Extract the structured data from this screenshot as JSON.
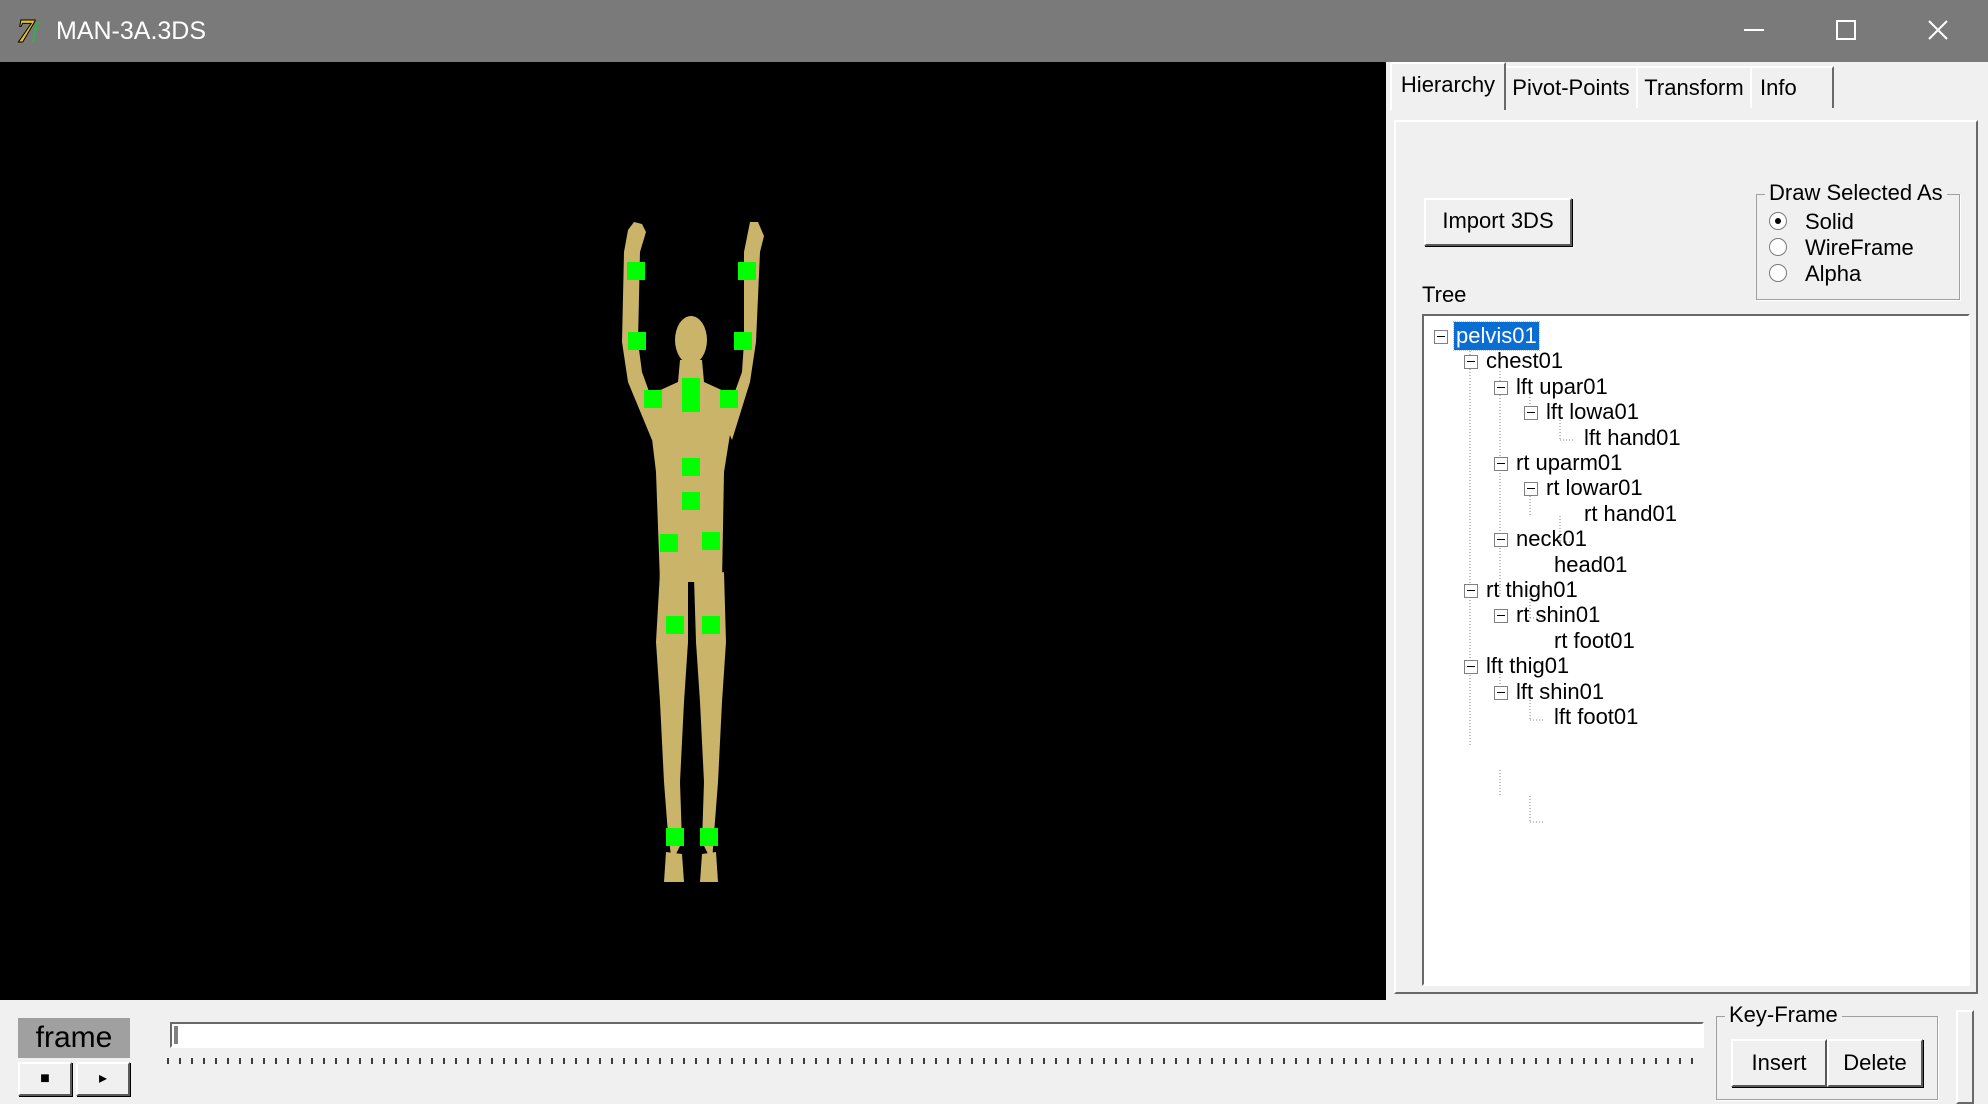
{
  "window": {
    "title": "MAN-3A.3DS"
  },
  "tabs": [
    {
      "label": "Hierarchy",
      "active": true
    },
    {
      "label": "Pivot-Points",
      "active": false
    },
    {
      "label": "Transform",
      "active": false
    },
    {
      "label": "Info",
      "active": false
    }
  ],
  "hierarchy": {
    "import_label": "Import 3DS",
    "draw_selected": {
      "title": "Draw Selected As",
      "options": [
        "Solid",
        "WireFrame",
        "Alpha"
      ],
      "selected": "Solid"
    },
    "tree_label": "Tree",
    "tree_nodes": [
      {
        "label": "pelvis01",
        "depth": 0,
        "expandable": true,
        "selected": true
      },
      {
        "label": "chest01",
        "depth": 1,
        "expandable": true
      },
      {
        "label": "lft upar01",
        "depth": 2,
        "expandable": true
      },
      {
        "label": "lft lowa01",
        "depth": 3,
        "expandable": true
      },
      {
        "label": "lft hand01",
        "depth": 4,
        "expandable": false
      },
      {
        "label": "rt uparm01",
        "depth": 2,
        "expandable": true
      },
      {
        "label": "rt lowar01",
        "depth": 3,
        "expandable": true
      },
      {
        "label": "rt hand01",
        "depth": 4,
        "expandable": false
      },
      {
        "label": "neck01",
        "depth": 2,
        "expandable": true
      },
      {
        "label": "head01",
        "depth": 3,
        "expandable": false
      },
      {
        "label": "rt thigh01",
        "depth": 1,
        "expandable": true
      },
      {
        "label": "rt shin01",
        "depth": 2,
        "expandable": true
      },
      {
        "label": "rt foot01",
        "depth": 3,
        "expandable": false
      },
      {
        "label": "lft thig01",
        "depth": 1,
        "expandable": true
      },
      {
        "label": "lft shin01",
        "depth": 2,
        "expandable": true
      },
      {
        "label": "lft foot01",
        "depth": 3,
        "expandable": false
      }
    ]
  },
  "timeline": {
    "frame_label": "frame",
    "stop_symbol": "■",
    "play_symbol": "▸",
    "position": 0
  },
  "keyframe": {
    "title": "Key-Frame",
    "insert_label": "Insert",
    "delete_label": "Delete"
  },
  "colors": {
    "titlebar": "#7a7a7a",
    "viewport": "#000000",
    "body": "#c9b46a",
    "pivot": "#00ff00",
    "selection": "#0a6dd2"
  },
  "icons": {
    "app": "app-logo-icon",
    "minimize": "minimize-icon",
    "maximize": "maximize-icon",
    "close": "close-icon",
    "expander": "tree-collapse-icon"
  }
}
